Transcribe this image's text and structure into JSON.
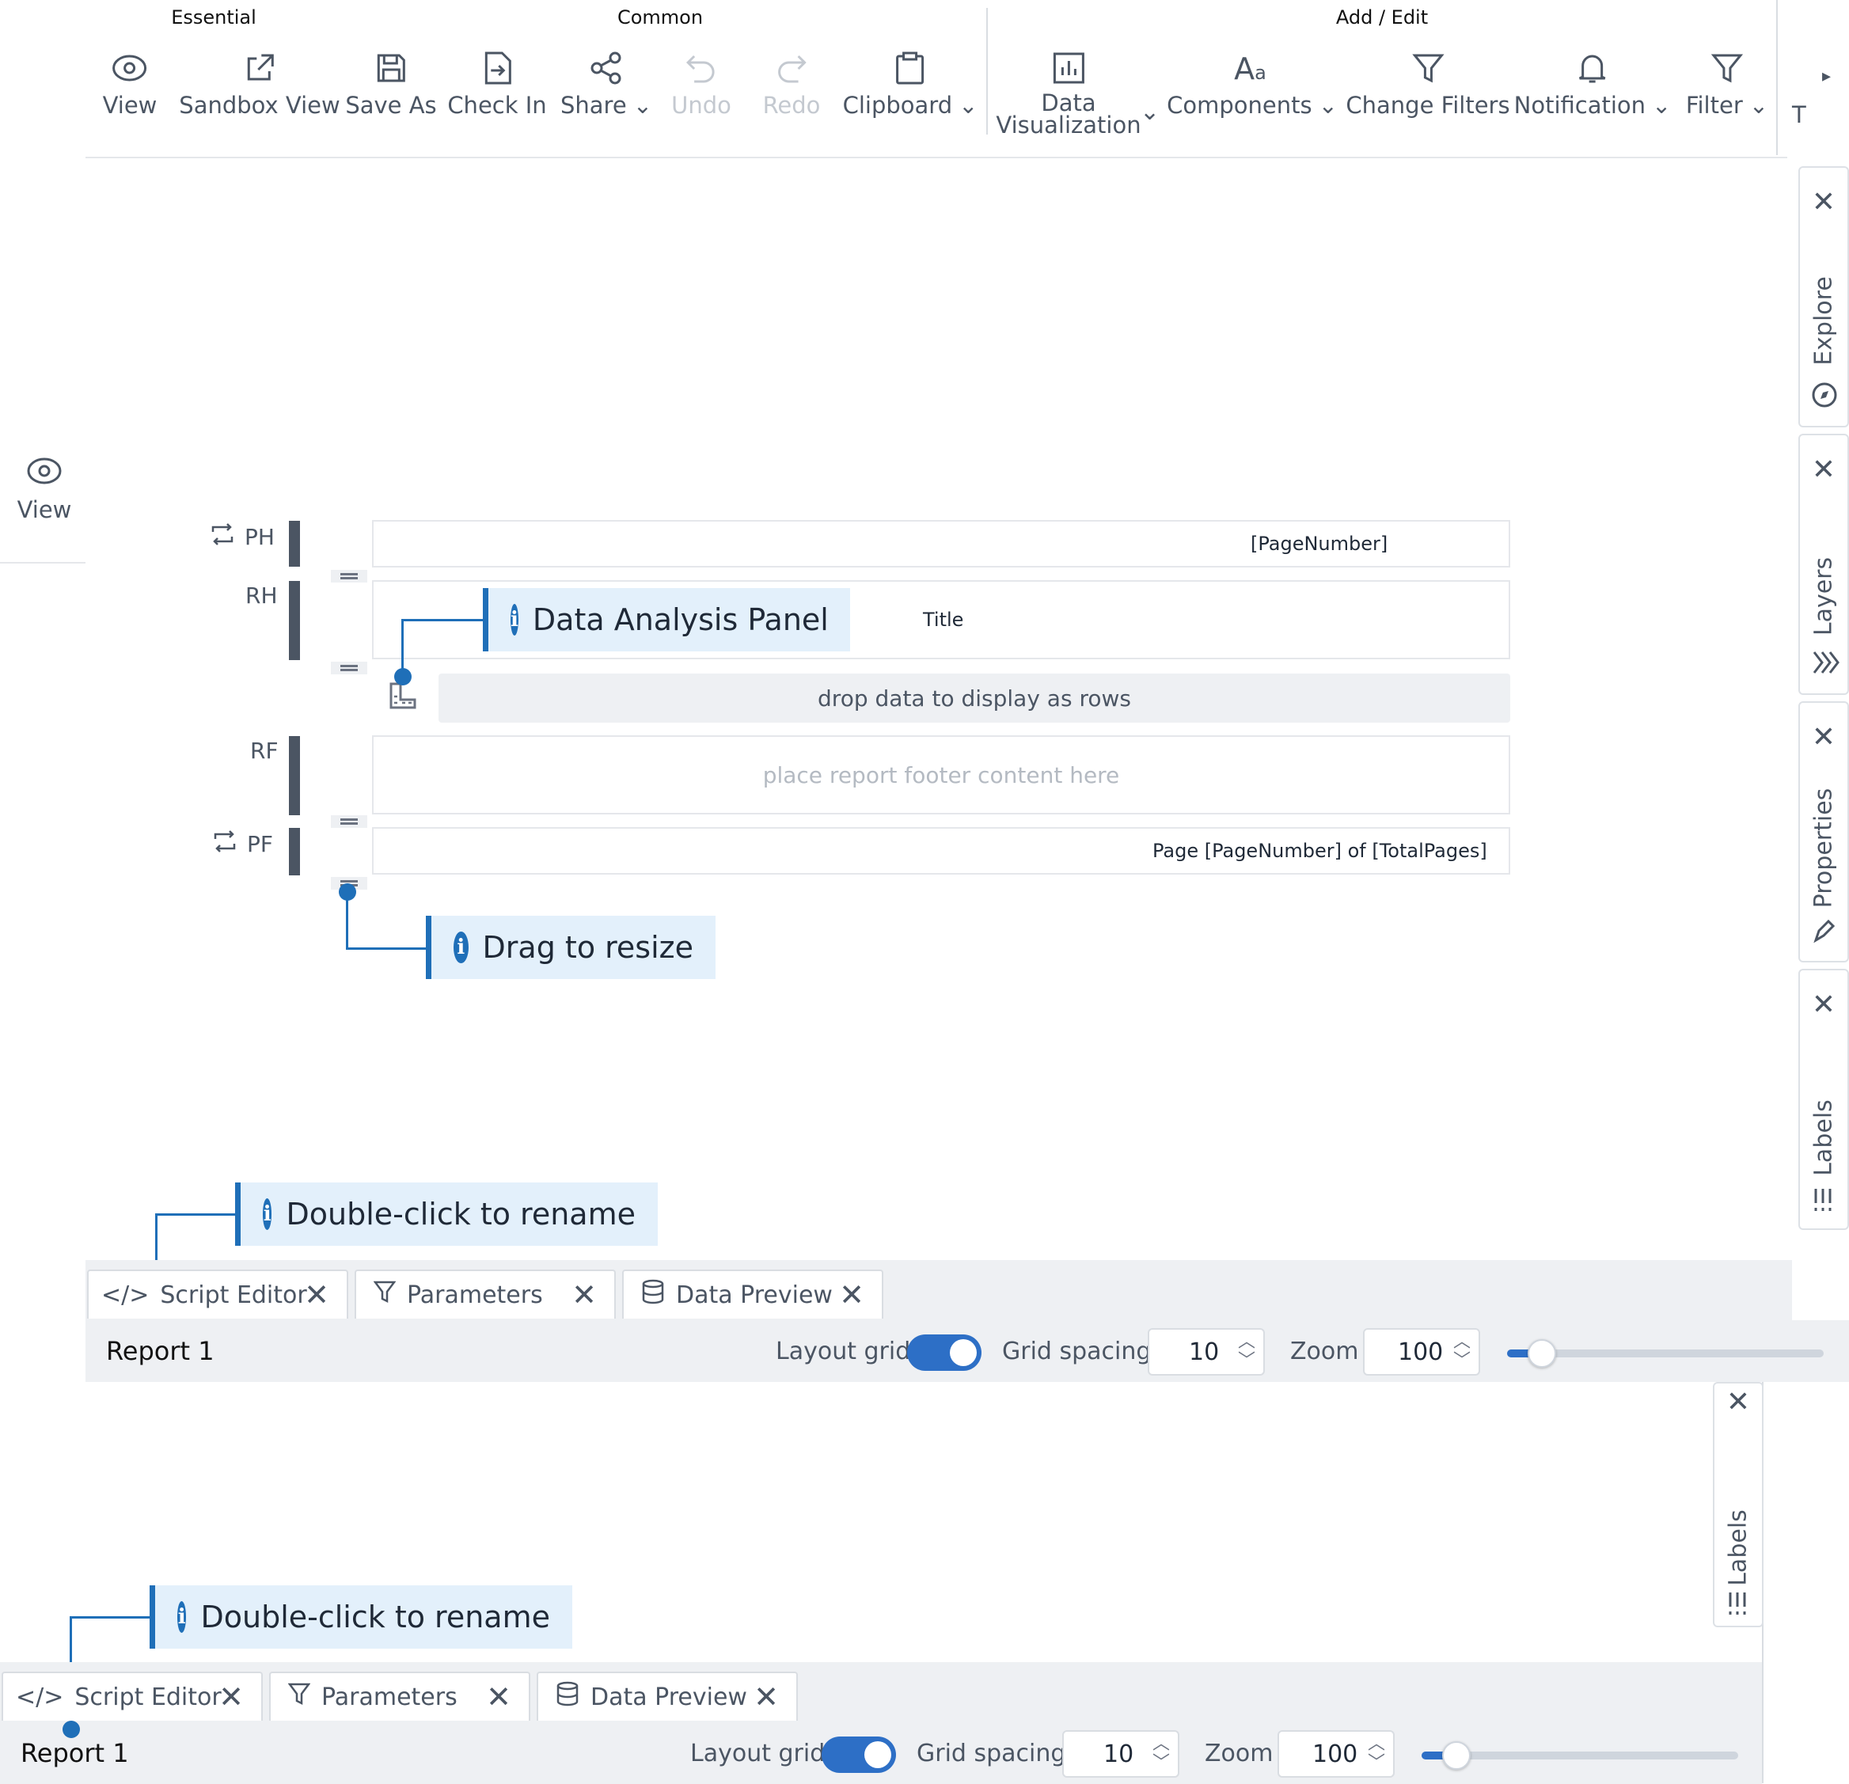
{
  "toolbar": {
    "groups": {
      "essential": "Essential",
      "common": "Common",
      "add_edit": "Add / Edit"
    },
    "buttons": {
      "view": "View",
      "sandbox_view": "Sandbox View",
      "save_as": "Save As",
      "check_in": "Check In",
      "share": "Share",
      "undo": "Undo",
      "redo": "Redo",
      "clipboard": "Clipboard",
      "data_viz_1": "Data",
      "data_viz_2": "Visualization",
      "components": "Components",
      "change_filters": "Change Filters",
      "notification": "Notification",
      "filter": "Filter",
      "overflow_text": "T"
    }
  },
  "left_panel": {
    "view_label": "View"
  },
  "report": {
    "bands": {
      "ph": "PH",
      "rh": "RH",
      "rf": "RF",
      "pf": "PF"
    },
    "ph_text": "[PageNumber]",
    "rh_title": "Title",
    "rows_placeholder": "drop data to display as rows",
    "rf_placeholder": "place report footer content here",
    "pf_text": "Page [PageNumber] of [TotalPages]"
  },
  "tips": {
    "data_panel": "Data Analysis Panel",
    "resize": "Drag to resize",
    "rename": "Double-click to rename"
  },
  "side_tabs": {
    "explore": "Explore",
    "layers": "Layers",
    "properties": "Properties",
    "labels": "Labels"
  },
  "bottom_tabs": {
    "script_editor": "Script Editor",
    "parameters": "Parameters",
    "data_preview": "Data Preview"
  },
  "status": {
    "report_name": "Report 1",
    "layout_grid": "Layout grid",
    "layout_grid_on": true,
    "grid_spacing_label": "Grid spacing",
    "grid_spacing": "10",
    "zoom_label": "Zoom",
    "zoom": "100",
    "zoom_slider_fraction": 0.11
  },
  "colors": {
    "accent": "#1f6fb8",
    "toggle": "#2d6fc6",
    "band": "#4b5563"
  }
}
